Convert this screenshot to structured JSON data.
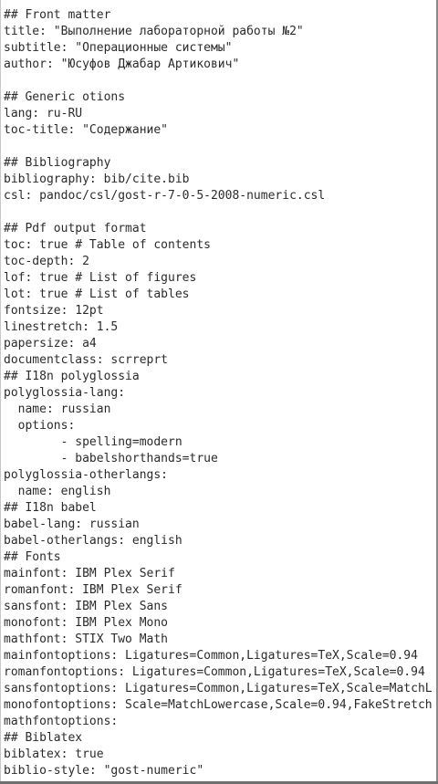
{
  "editor": {
    "lines": [
      "## Front matter",
      "title: \"Выполнение лабораторной работы №2\"",
      "subtitle: \"Операционные системы\"",
      "author: \"Юсуфов Джабар Артикович\"",
      "",
      "## Generic otions",
      "lang: ru-RU",
      "toc-title: \"Содержание\"",
      "",
      "## Bibliography",
      "bibliography: bib/cite.bib",
      "csl: pandoc/csl/gost-r-7-0-5-2008-numeric.csl",
      "",
      "## Pdf output format",
      "toc: true # Table of contents",
      "toc-depth: 2",
      "lof: true # List of figures",
      "lot: true # List of tables",
      "fontsize: 12pt",
      "linestretch: 1.5",
      "papersize: a4",
      "documentclass: scrreprt",
      "## I18n polyglossia",
      "polyglossia-lang:",
      "  name: russian",
      "  options:",
      "        - spelling=modern",
      "        - babelshorthands=true",
      "polyglossia-otherlangs:",
      "  name: english",
      "## I18n babel",
      "babel-lang: russian",
      "babel-otherlangs: english",
      "## Fonts",
      "mainfont: IBM Plex Serif",
      "romanfont: IBM Plex Serif",
      "sansfont: IBM Plex Sans",
      "monofont: IBM Plex Mono",
      "mathfont: STIX Two Math",
      "mainfontoptions: Ligatures=Common,Ligatures=TeX,Scale=0.94",
      "romanfontoptions: Ligatures=Common,Ligatures=TeX,Scale=0.94",
      "sansfontoptions: Ligatures=Common,Ligatures=TeX,Scale=MatchL",
      "monofontoptions: Scale=MatchLowercase,Scale=0.94,FakeStretch",
      "mathfontoptions:",
      "## Biblatex",
      "biblatex: true",
      "biblio-style: \"gost-numeric\""
    ]
  }
}
